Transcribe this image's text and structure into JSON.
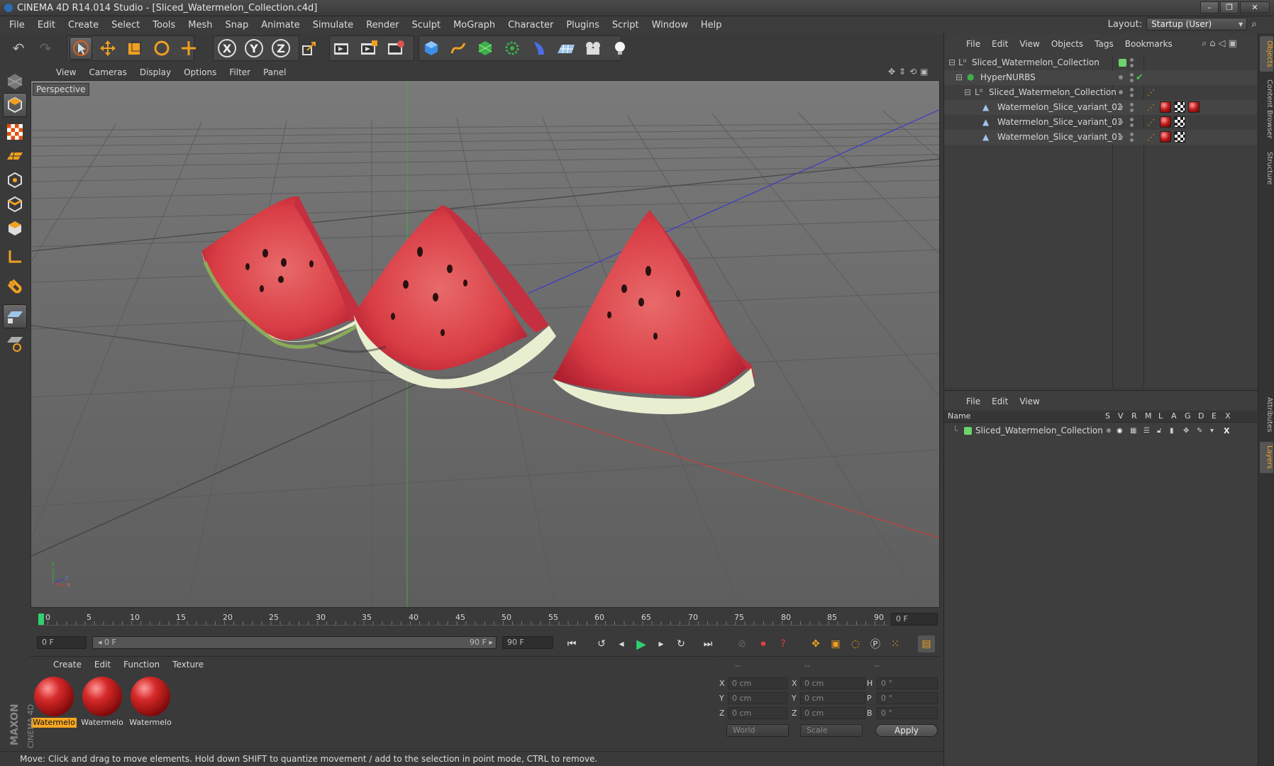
{
  "window": {
    "title": "CINEMA 4D R14.014 Studio - [Sliced_Watermelon_Collection.c4d]",
    "min": "–",
    "max": "❐",
    "close": "✕"
  },
  "menubar": {
    "items": [
      "File",
      "Edit",
      "Create",
      "Select",
      "Tools",
      "Mesh",
      "Snap",
      "Animate",
      "Simulate",
      "Render",
      "Sculpt",
      "MoGraph",
      "Character",
      "Plugins",
      "Script",
      "Window",
      "Help"
    ],
    "layout_label": "Layout:",
    "layout_value": "Startup (User)"
  },
  "viewport": {
    "menu": [
      "View",
      "Cameras",
      "Display",
      "Options",
      "Filter",
      "Panel"
    ],
    "label": "Perspective",
    "axis_y": "y",
    "axis_z": "z",
    "axis_x": "x"
  },
  "timeline": {
    "ticks": [
      "0",
      "5",
      "10",
      "15",
      "20",
      "25",
      "30",
      "35",
      "40",
      "45",
      "50",
      "55",
      "60",
      "65",
      "70",
      "75",
      "80",
      "85",
      "90"
    ],
    "end_field": "0 F"
  },
  "transport": {
    "current": "0 F",
    "range_start": "◂ 0 F",
    "range_end": "90 F ▸",
    "max": "90 F"
  },
  "materials": {
    "menu": [
      "Create",
      "Edit",
      "Function",
      "Texture"
    ],
    "items": [
      {
        "label": "Watermelo",
        "selected": true
      },
      {
        "label": "Watermelo",
        "selected": false
      },
      {
        "label": "Watermelo",
        "selected": false
      }
    ]
  },
  "coords": {
    "headers": [
      "--",
      "--",
      "--"
    ],
    "rows": [
      {
        "a": "X",
        "av": "0 cm",
        "b": "X",
        "bv": "0 cm",
        "c": "H",
        "cv": "0 °"
      },
      {
        "a": "Y",
        "av": "0 cm",
        "b": "Y",
        "bv": "0 cm",
        "c": "P",
        "cv": "0 °"
      },
      {
        "a": "Z",
        "av": "0 cm",
        "b": "Z",
        "bv": "0 cm",
        "c": "B",
        "cv": "0 °"
      }
    ],
    "mode1": "World",
    "mode2": "Scale",
    "apply": "Apply"
  },
  "status": "Move: Click and drag to move elements. Hold down SHIFT to quantize movement / add to the selection in point mode, CTRL to remove.",
  "brand": {
    "maxon": "MAXON",
    "c4d": "CINEMA 4D"
  },
  "objects": {
    "menu": [
      "File",
      "Edit",
      "View",
      "Objects",
      "Tags",
      "Bookmarks"
    ],
    "rows": [
      {
        "name": "Sliced_Watermelon_Collection",
        "indent": 0
      },
      {
        "name": "HyperNURBS",
        "indent": 1
      },
      {
        "name": "Sliced_Watermelon_Collection",
        "indent": 2
      },
      {
        "name": "Watermelon_Slice_variant_02",
        "indent": 3
      },
      {
        "name": "Watermelon_Slice_variant_03",
        "indent": 3
      },
      {
        "name": "Watermelon_Slice_variant_01",
        "indent": 3
      }
    ]
  },
  "layers": {
    "menu": [
      "File",
      "Edit",
      "View"
    ],
    "columns": [
      "Name",
      "S",
      "V",
      "R",
      "M",
      "L",
      "A",
      "G",
      "D",
      "E",
      "X"
    ],
    "rows": [
      {
        "name": "Sliced_Watermelon_Collection",
        "color": "#6cd36c"
      }
    ]
  },
  "side_tabs": [
    "Objects",
    "Content Browser",
    "Structure",
    "Attributes",
    "Layers"
  ],
  "colors": {
    "accent": "#f5a623",
    "layer_green": "#6cd36c",
    "x_axis": "#c84040",
    "y_axis": "#3cae3c",
    "z_axis": "#3a3ac8"
  }
}
